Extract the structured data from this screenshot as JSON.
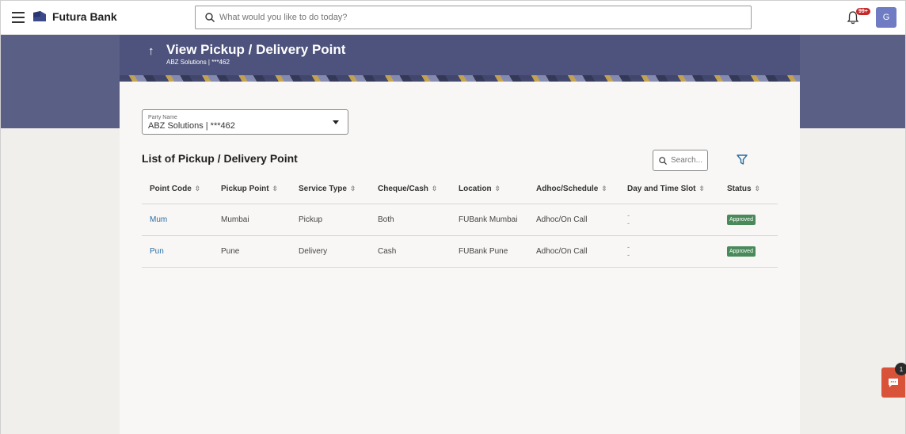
{
  "app": {
    "brand": "Futura Bank",
    "search_placeholder": "What would you like to do today?",
    "notification_count": "99+",
    "avatar_initial": "G"
  },
  "page": {
    "title": "View Pickup / Delivery Point",
    "subtitle": "ABZ Solutions | ***462"
  },
  "party": {
    "label": "Party Name",
    "value": "ABZ Solutions | ***462"
  },
  "list": {
    "title": "List of Pickup / Delivery Point",
    "search_placeholder": "Search...",
    "columns": [
      "Point Code",
      "Pickup Point",
      "Service Type",
      "Cheque/Cash",
      "Location",
      "Adhoc/Schedule",
      "Day and Time Slot",
      "Status"
    ],
    "rows": [
      {
        "point_code": "Mum",
        "pickup_point": "Mumbai",
        "service_type": "Pickup",
        "cheque_cash": "Both",
        "location": "FUBank Mumbai",
        "adhoc_schedule": "Adhoc/On Call",
        "slot_day": "-",
        "slot_time": "-",
        "status": "Approved"
      },
      {
        "point_code": "Pun",
        "pickup_point": "Pune",
        "service_type": "Delivery",
        "cheque_cash": "Cash",
        "location": "FUBank Pune",
        "adhoc_schedule": "Adhoc/On Call",
        "slot_day": "-",
        "slot_time": "-",
        "status": "Approved"
      }
    ]
  },
  "chat": {
    "badge": "1"
  },
  "colors": {
    "header": "#4e537d",
    "link": "#2b6ea3",
    "approved": "#4a8a5a",
    "chat": "#d9523a"
  }
}
